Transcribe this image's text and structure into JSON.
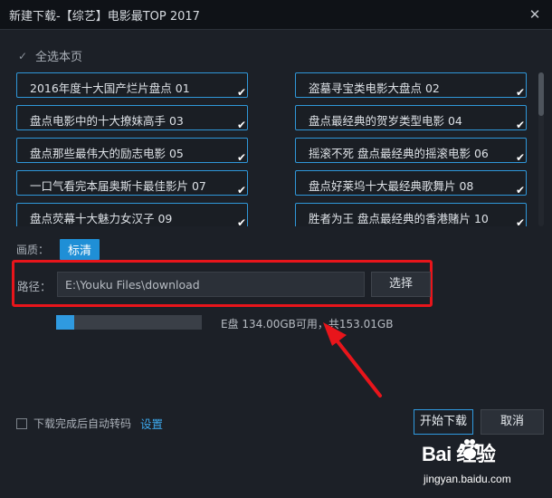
{
  "window": {
    "title": "新建下载-【综艺】电影最TOP 2017",
    "close_glyph": "✕"
  },
  "select_all": {
    "label": "全选本页",
    "checked": true,
    "check_glyph": "✓"
  },
  "videos": [
    {
      "title": "2016年度十大国产烂片盘点 01",
      "selected": true
    },
    {
      "title": "盗墓寻宝类电影大盘点 02",
      "selected": true
    },
    {
      "title": "盘点电影中的十大撩妹高手 03",
      "selected": true
    },
    {
      "title": "盘点最经典的贺岁类型电影 04",
      "selected": true
    },
    {
      "title": "盘点那些最伟大的励志电影 05",
      "selected": true
    },
    {
      "title": "摇滚不死 盘点最经典的摇滚电影 06",
      "selected": true
    },
    {
      "title": "一口气看完本届奥斯卡最佳影片 07",
      "selected": true
    },
    {
      "title": "盘点好莱坞十大最经典歌舞片 08",
      "selected": true
    },
    {
      "title": "盘点荧幕十大魅力女汉子 09",
      "selected": true
    },
    {
      "title": "胜者为王 盘点最经典的香港赌片 10",
      "selected": true
    }
  ],
  "item_check_glyph": "✔",
  "quality": {
    "label": "画质：",
    "value": "标清"
  },
  "path": {
    "label": "路径：",
    "value": "E:\\Youku Files\\download",
    "choose_label": "选择"
  },
  "disk": {
    "text": "E盘 134.00GB可用，共153.01GB",
    "used_fraction": 0.124
  },
  "footer": {
    "auto_transcode_label": "下载完成后自动转码",
    "auto_transcode_checked": false,
    "settings_label": "设置",
    "start_label": "开始下载",
    "cancel_label": "取消"
  },
  "watermark": {
    "logo": "Bai  经验",
    "url": "jingyan.baidu.com"
  },
  "colors": {
    "accent": "#2f9ae0",
    "highlight": "#e8151b",
    "background": "#1c2027"
  }
}
